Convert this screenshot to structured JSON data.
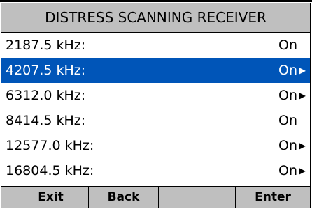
{
  "screen": {
    "title": "DISTRESS SCANNING RECEIVER"
  },
  "channels": [
    {
      "frequency": "2187.5 kHz:",
      "status": "On",
      "submenu": false,
      "selected": false
    },
    {
      "frequency": "4207.5 kHz:",
      "status": "On",
      "submenu": true,
      "selected": true
    },
    {
      "frequency": "6312.0 kHz:",
      "status": "On",
      "submenu": true,
      "selected": false
    },
    {
      "frequency": "8414.5 kHz:",
      "status": "On",
      "submenu": false,
      "selected": false
    },
    {
      "frequency": "12577.0 kHz:",
      "status": "On",
      "submenu": true,
      "selected": false
    },
    {
      "frequency": "16804.5 kHz:",
      "status": "On",
      "submenu": true,
      "selected": false
    }
  ],
  "softkeys": {
    "exit": "Exit",
    "back": "Back",
    "empty": "",
    "enter": "Enter"
  },
  "icons": {
    "submenu_arrow": "triangle-right-icon"
  },
  "colors": {
    "highlight": "#0055b8",
    "bar_gray": "#bfbfbf"
  }
}
